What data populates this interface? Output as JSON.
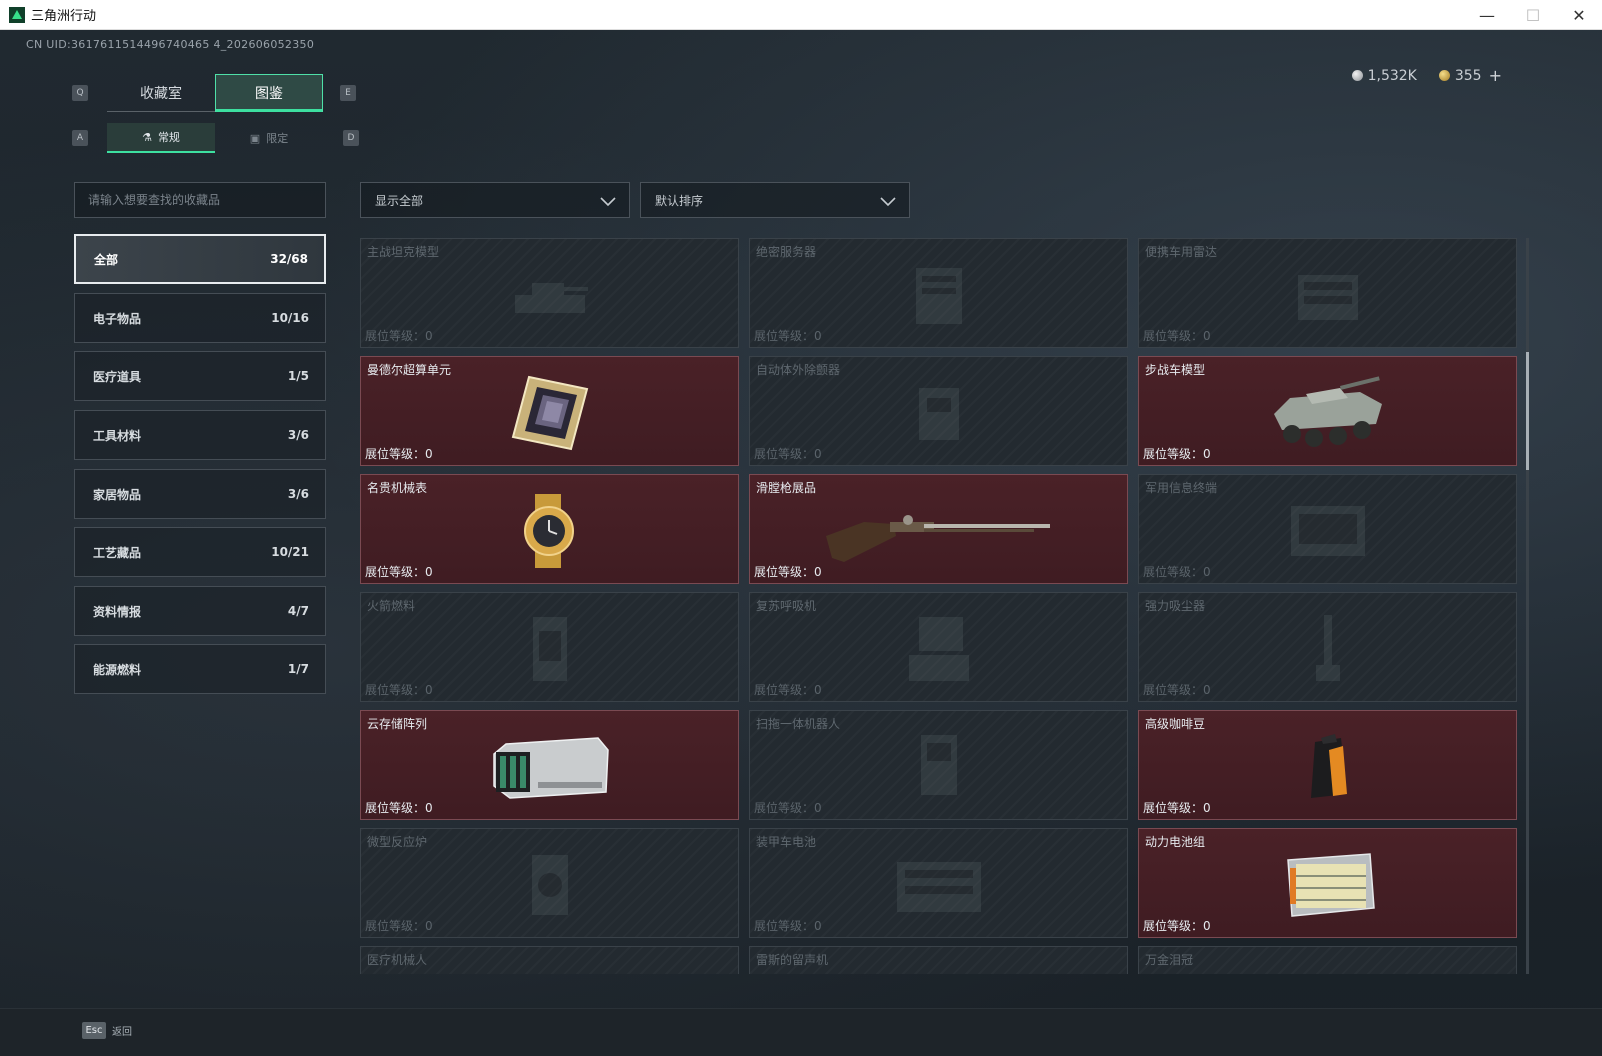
{
  "window": {
    "title": "三角洲行动",
    "minimize": "—",
    "maximize": "☐",
    "close": "✕"
  },
  "uid": "CN UID:3617611514496740465 4_202606052350",
  "currency": {
    "silver": "1,532K",
    "gold": "355",
    "add": "+"
  },
  "keys": {
    "q": "Q",
    "e": "E",
    "a": "A",
    "d": "D"
  },
  "main_tabs": [
    {
      "label": "收藏室"
    },
    {
      "label": "图鉴"
    }
  ],
  "sub_tabs": [
    {
      "label": "常规",
      "icon": "flask-icon"
    },
    {
      "label": "限定",
      "icon": "image-icon"
    }
  ],
  "search": {
    "placeholder": "请输入想要查找的收藏品"
  },
  "filters": {
    "show": "显示全部",
    "sort": "默认排序"
  },
  "categories": [
    {
      "name": "全部",
      "count": "32/68"
    },
    {
      "name": "电子物品",
      "count": "10/16"
    },
    {
      "name": "医疗道具",
      "count": "1/5"
    },
    {
      "name": "工具材料",
      "count": "3/6"
    },
    {
      "name": "家居物品",
      "count": "3/6"
    },
    {
      "name": "工艺藏品",
      "count": "10/21"
    },
    {
      "name": "资料情报",
      "count": "4/7"
    },
    {
      "name": "能源燃料",
      "count": "1/7"
    }
  ],
  "level_label": "展位等级：",
  "items": [
    {
      "name": "主战坦克模型",
      "level": "0",
      "owned": false
    },
    {
      "name": "绝密服务器",
      "level": "0",
      "owned": false
    },
    {
      "name": "便携车用雷达",
      "level": "0",
      "owned": false
    },
    {
      "name": "曼德尔超算单元",
      "level": "0",
      "owned": true
    },
    {
      "name": "自动体外除颤器",
      "level": "0",
      "owned": false
    },
    {
      "name": "步战车模型",
      "level": "0",
      "owned": true
    },
    {
      "name": "名贵机械表",
      "level": "0",
      "owned": true
    },
    {
      "name": "滑膛枪展品",
      "level": "0",
      "owned": true
    },
    {
      "name": "军用信息终端",
      "level": "0",
      "owned": false
    },
    {
      "name": "火箭燃料",
      "level": "0",
      "owned": false
    },
    {
      "name": "复苏呼吸机",
      "level": "0",
      "owned": false
    },
    {
      "name": "强力吸尘器",
      "level": "0",
      "owned": false
    },
    {
      "name": "云存储阵列",
      "level": "0",
      "owned": true
    },
    {
      "name": "扫拖一体机器人",
      "level": "0",
      "owned": false
    },
    {
      "name": "高级咖啡豆",
      "level": "0",
      "owned": true
    },
    {
      "name": "微型反应炉",
      "level": "0",
      "owned": false
    },
    {
      "name": "装甲车电池",
      "level": "0",
      "owned": false
    },
    {
      "name": "动力电池组",
      "level": "0",
      "owned": true
    },
    {
      "name": "医疗机械人",
      "level": "",
      "owned": false
    },
    {
      "name": "雷斯的留声机",
      "level": "",
      "owned": false
    },
    {
      "name": "万金泪冠",
      "level": "",
      "owned": false
    }
  ],
  "bottom": {
    "esc_key": "Esc",
    "back": "返回"
  },
  "colors": {
    "accent": "#3de0a0",
    "owned_bg": "#4a2127",
    "locked_bg": "#232a30"
  }
}
